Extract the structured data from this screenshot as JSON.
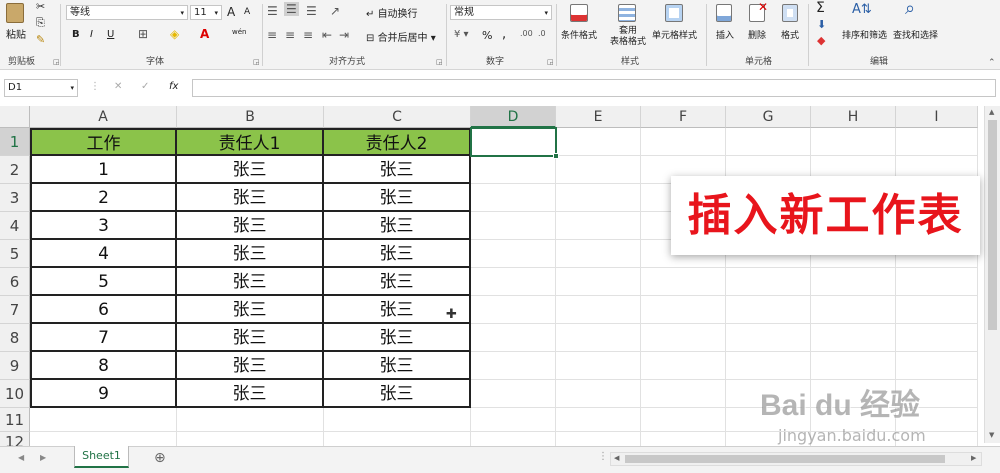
{
  "ribbon": {
    "clipboard": {
      "paste": "粘贴",
      "label": "剪贴板"
    },
    "font": {
      "name": "等线",
      "size": "11",
      "grow": "A",
      "shrink": "A",
      "bold": "B",
      "italic": "I",
      "underline": "U",
      "phonetic": "wén",
      "label": "字体"
    },
    "alignment": {
      "wrap": "自动换行",
      "merge": "合并后居中",
      "label": "对齐方式"
    },
    "number": {
      "format": "常规",
      "percent": "%",
      "comma": ",",
      "label": "数字"
    },
    "styles": {
      "conditional": "条件格式",
      "table_line1": "套用",
      "table_line2": "表格格式",
      "cell_styles": "单元格样式",
      "label": "样式"
    },
    "cells": {
      "insert": "插入",
      "delete": "删除",
      "format": "格式",
      "label": "单元格"
    },
    "editing": {
      "sum": "Σ",
      "sort": "排序和筛选",
      "find": "查找和选择",
      "label": "编辑"
    }
  },
  "formula_bar": {
    "name_box": "D1",
    "fx": "fx",
    "value": ""
  },
  "sheet": {
    "columns": [
      "A",
      "B",
      "C",
      "D",
      "E",
      "F",
      "G",
      "H",
      "I"
    ],
    "rows": [
      "1",
      "2",
      "3",
      "4",
      "5",
      "6",
      "7",
      "8",
      "9",
      "10",
      "11",
      "12"
    ],
    "headers": [
      "工作",
      "责任人1",
      "责任人2"
    ],
    "data": [
      [
        "1",
        "张三",
        "张三"
      ],
      [
        "2",
        "张三",
        "张三"
      ],
      [
        "3",
        "张三",
        "张三"
      ],
      [
        "4",
        "张三",
        "张三"
      ],
      [
        "5",
        "张三",
        "张三"
      ],
      [
        "6",
        "张三",
        "张三"
      ],
      [
        "7",
        "张三",
        "张三"
      ],
      [
        "8",
        "张三",
        "张三"
      ],
      [
        "9",
        "张三",
        "张三"
      ]
    ],
    "header_color": "#8bc34a",
    "selected_cell": "D1"
  },
  "tabs": {
    "sheet1": "Sheet1",
    "add": "⊕"
  },
  "overlay": {
    "banner": "插入新工作表",
    "watermark_logo": "Bai du 经验",
    "watermark_url": "jingyan.baidu.com"
  }
}
